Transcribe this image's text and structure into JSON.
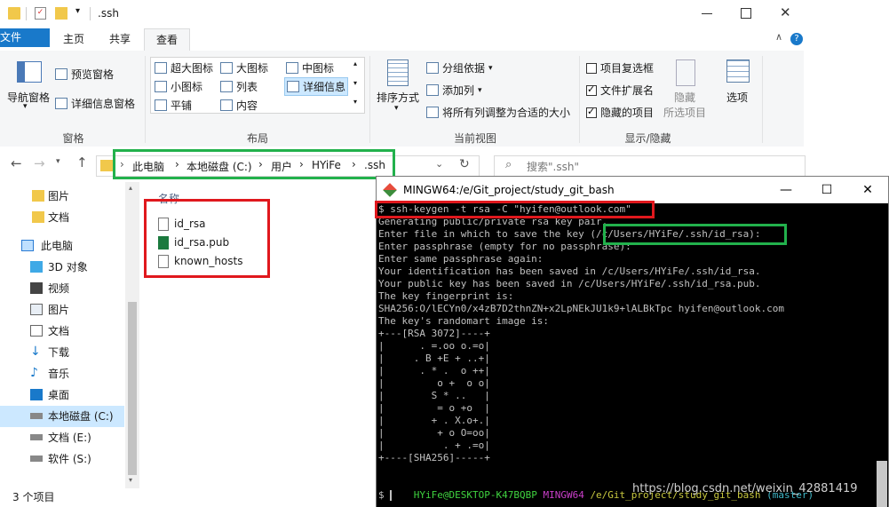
{
  "explorer": {
    "title": ".ssh",
    "tabs": {
      "file": "文件",
      "home": "主页",
      "share": "共享",
      "view": "查看"
    },
    "ribbon": {
      "pane": {
        "nav_pane": "导航窗格",
        "preview_pane": "预览窗格",
        "details_pane": "详细信息窗格",
        "label": "窗格"
      },
      "layout": {
        "xl_icons": "超大图标",
        "l_icons": "大图标",
        "m_icons": "中图标",
        "s_icons": "小图标",
        "list": "列表",
        "details": "详细信息",
        "tiles": "平铺",
        "content": "内容",
        "label": "布局"
      },
      "current_view": {
        "sort_by": "排序方式",
        "group_by": "分组依据",
        "add_columns": "添加列",
        "size_all_columns": "将所有列调整为合适的大小",
        "label": "当前视图"
      },
      "show_hide": {
        "item_checkboxes": "项目复选框",
        "file_ext": "文件扩展名",
        "hidden_items": "隐藏的项目",
        "hide": "隐藏",
        "hide2": "所选项目",
        "options": "选项",
        "label": "显示/隐藏"
      }
    },
    "breadcrumb": {
      "c1": "此电脑",
      "c2": "本地磁盘 (C:)",
      "c3": "用户",
      "c4": "HYiFe",
      "c5": ".ssh"
    },
    "search_placeholder": "搜索\".ssh\"",
    "column_header": "名称",
    "nav": [
      "图片",
      "文档",
      "此电脑",
      "3D 对象",
      "视频",
      "图片",
      "文档",
      "下载",
      "音乐",
      "桌面",
      "本地磁盘 (C:)",
      "文档 (E:)",
      "软件 (S:)"
    ],
    "files": [
      "id_rsa",
      "id_rsa.pub",
      "known_hosts"
    ],
    "status": "3 个项目"
  },
  "terminal": {
    "title": "MINGW64:/e/Git_project/study_git_bash",
    "lines": [
      "$ ssh-keygen -t rsa -C \"hyifen@outlook.com\"",
      "Generating public/private rsa key pair.",
      "Enter file in which to save the key (/c/Users/HYiFe/.ssh/id_rsa):",
      "Enter passphrase (empty for no passphrase):",
      "Enter same passphrase again:",
      "Your identification has been saved in /c/Users/HYiFe/.ssh/id_rsa.",
      "Your public key has been saved in /c/Users/HYiFe/.ssh/id_rsa.pub.",
      "The key fingerprint is:",
      "SHA256:O/lECYn0/x4zB7D2thnZN+x2LpNEkJU1k9+lALBkTpc hyifen@outlook.com",
      "The key's randomart image is:",
      "+---[RSA 3072]----+",
      "|      . =.oo o.=o|",
      "|     . B +E + ..+|",
      "|      . * .  o ++|",
      "|         o +  o o|",
      "|        S * ..   |",
      "|         = o +o  |",
      "|        + . X.o+.|",
      "|         + o O=oo|",
      "|          . + .=o|",
      "+----[SHA256]-----+",
      ""
    ],
    "prompt": {
      "user": "HYiFe@DESKTOP-K47BQBP",
      "shell": "MINGW64",
      "path": "/e/Git_project/study_git_bash",
      "branch": "(master)",
      "cursor": "$"
    }
  },
  "watermark": "https://blog.csdn.net/weixin_42881419",
  "colors": {
    "accent": "#1979ca",
    "red_box": "#e0181d",
    "green_box": "#22b14c",
    "prompt_green": "#3fd23f",
    "prompt_magenta": "#c93fc9",
    "prompt_yellow": "#c8c83f",
    "prompt_cyan": "#3fb8c8"
  }
}
